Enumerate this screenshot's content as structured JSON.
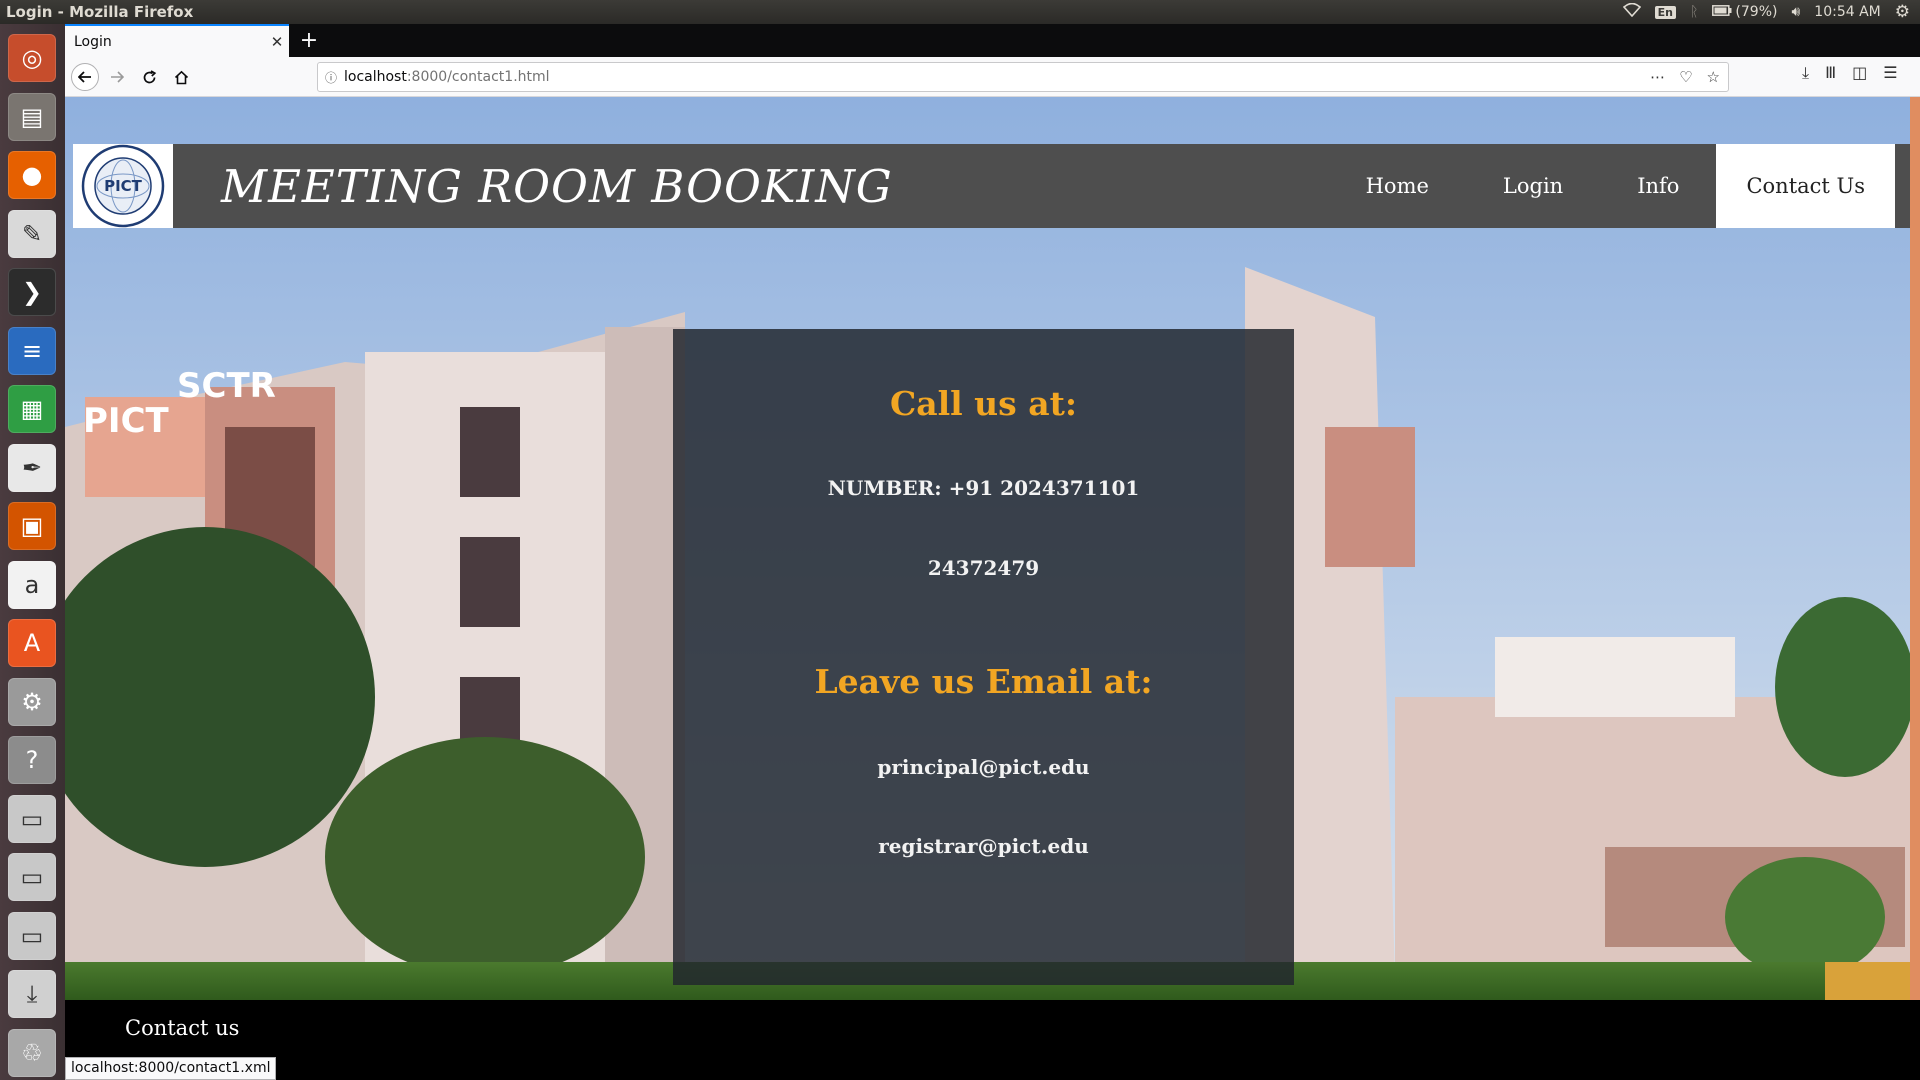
{
  "os_panel": {
    "window_title": "Login - Mozilla Firefox",
    "keyboard_layout": "En",
    "battery": "(79%)",
    "clock": "10:54 AM",
    "icons": [
      "wifi-icon",
      "bluetooth-icon",
      "battery-icon",
      "volume-icon",
      "settings-gear-icon"
    ]
  },
  "launcher": {
    "items": [
      {
        "name": "ubuntu-dash-icon",
        "color": "#c64d2c"
      },
      {
        "name": "files-icon",
        "color": "#7a7570"
      },
      {
        "name": "firefox-icon",
        "color": "#e66000"
      },
      {
        "name": "text-editor-icon",
        "color": "#d9d9d9"
      },
      {
        "name": "terminal-icon",
        "color": "#2c2c2c"
      },
      {
        "name": "writer-icon",
        "color": "#2a6bbf"
      },
      {
        "name": "calc-icon",
        "color": "#2f9e44"
      },
      {
        "name": "document-viewer-icon",
        "color": "#e8e8e8"
      },
      {
        "name": "impress-icon",
        "color": "#d35400"
      },
      {
        "name": "amazon-icon",
        "color": "#f2f2f2"
      },
      {
        "name": "software-center-icon",
        "color": "#e95420"
      },
      {
        "name": "system-settings-icon",
        "color": "#9a9a9a"
      },
      {
        "name": "help-icon",
        "color": "#8c8c8c"
      },
      {
        "name": "drive-icon",
        "color": "#c8c8c8"
      },
      {
        "name": "drive-icon",
        "color": "#c8c8c8"
      },
      {
        "name": "drive-icon",
        "color": "#c8c8c8"
      },
      {
        "name": "installer-icon",
        "color": "#d0d0d0"
      },
      {
        "name": "trash-icon",
        "color": "#a8a8a8"
      }
    ]
  },
  "browser": {
    "tab_title": "Login",
    "url_host": "localhost",
    "url_rest": ":8000/contact1.html",
    "status_tooltip": "localhost:8000/contact1.xml"
  },
  "site": {
    "logo_text": "PICT",
    "title": "MEETING ROOM BOOKING",
    "nav": [
      {
        "label": "Home",
        "active": false
      },
      {
        "label": "Login",
        "active": false
      },
      {
        "label": "Info",
        "active": false
      },
      {
        "label": "Contact Us",
        "active": true
      }
    ],
    "building_signs": [
      "PICT",
      "SCTR"
    ],
    "contact": {
      "call_heading": "Call us at:",
      "number_line": "NUMBER: +91 2024371101",
      "number_line2": "24372479",
      "email_heading": "Leave us Email at:",
      "email1": "principal@pict.edu",
      "email2": "registrar@pict.edu"
    },
    "footer_text": "Contact us",
    "colors": {
      "header_bg": "#4e4e4e",
      "accent_heading": "#f2a623",
      "footer_bg": "#000000"
    }
  }
}
